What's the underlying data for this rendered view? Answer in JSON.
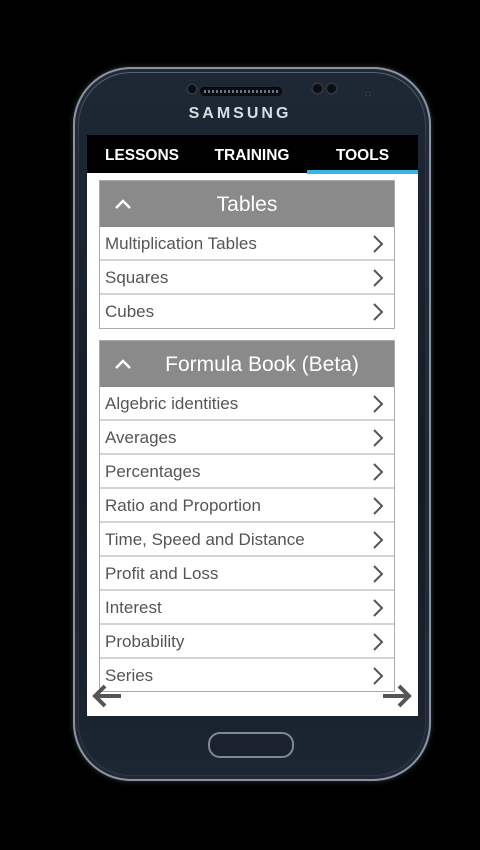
{
  "device": {
    "brand": "SAMSUNG"
  },
  "tabs": [
    {
      "label": "LESSONS"
    },
    {
      "label": "TRAINING"
    },
    {
      "label": "TOOLS"
    }
  ],
  "active_tab": "TOOLS",
  "accent_color": "#33b5e5",
  "sections": {
    "tables": {
      "title": "Tables",
      "icon": "chevron-up-icon",
      "items": [
        "Multiplication Tables",
        "Squares",
        "Cubes"
      ]
    },
    "formula_book": {
      "title": "Formula Book (Beta)",
      "icon": "chevron-up-icon",
      "items": [
        "Algebric identities",
        "Averages",
        "Percentages",
        "Ratio and Proportion",
        "Time, Speed and Distance",
        "Profit and Loss",
        "Interest",
        "Probability",
        "Series"
      ]
    }
  },
  "navigation": {
    "prev_icon": "arrow-left-icon",
    "next_icon": "arrow-right-icon"
  }
}
